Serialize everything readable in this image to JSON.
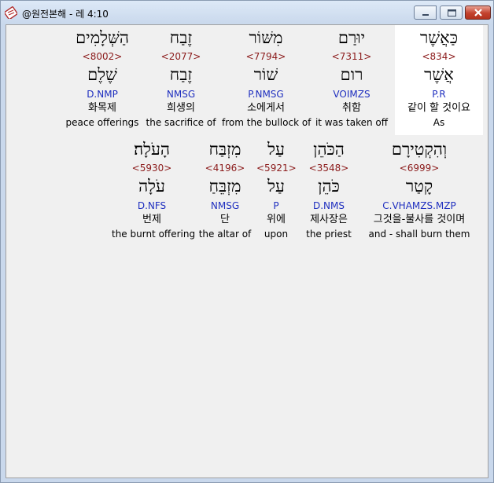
{
  "window": {
    "title": "@원전본해 - 레 4:10",
    "icons": [
      "app-bible-icon",
      "minimize-icon",
      "maximize-icon",
      "close-icon"
    ]
  },
  "colors": {
    "strong": "#8b1a1a",
    "parse": "#1f2fbf",
    "highlight_bg": "#ffffff",
    "content_bg": "#f0f0f0"
  },
  "words": [
    {
      "hebrew": "כַּאֲשֶׁר",
      "strong": "<834>",
      "root": "אֲשֶׁר",
      "parse": "P.R",
      "korean": "같이 할 것이요",
      "english": "As",
      "highlight": true
    },
    {
      "hebrew": "יוּרַם",
      "strong": "<7311>",
      "root": "רום",
      "parse": "VOIMZS",
      "korean": "취함",
      "english": "it was taken off",
      "highlight": false
    },
    {
      "hebrew": "מִשּׁוֹר",
      "strong": "<7794>",
      "root": "שׁוֹר",
      "parse": "P.NMSG",
      "korean": "소에게서",
      "english": "from the bullock of",
      "highlight": false
    },
    {
      "hebrew": "זֶבַח",
      "strong": "<2077>",
      "root": "זֶבַח",
      "parse": "NMSG",
      "korean": "희생의",
      "english": "the sacrifice of",
      "highlight": false
    },
    {
      "hebrew": "הַשְּׁלָמִים",
      "strong": "<8002>",
      "root": "שֶׁלֶם",
      "parse": "D.NMP",
      "korean": "화목제",
      "english": "peace offerings",
      "highlight": false
    },
    {
      "hebrew": "וְהִקְטִירָם",
      "strong": "<6999>",
      "root": "קָטַר",
      "parse": "C.VHAMZS.MZP",
      "korean": "그것을-불사를 것이며",
      "english": "and - shall burn them",
      "highlight": false
    },
    {
      "hebrew": "הַכֹּהֵן",
      "strong": "<3548>",
      "root": "כֹּהֵן",
      "parse": "D.NMS",
      "korean": "제사장은",
      "english": "the priest",
      "highlight": false
    },
    {
      "hebrew": "עַל",
      "strong": "<5921>",
      "root": "עַל",
      "parse": "P",
      "korean": "위에",
      "english": "upon",
      "highlight": false
    },
    {
      "hebrew": "מִזְבַּח",
      "strong": "<4196>",
      "root": "מִזְבֵּחַ",
      "parse": "NMSG",
      "korean": "단",
      "english": "the altar of",
      "highlight": false
    },
    {
      "hebrew": "הָעֹלָה׃",
      "strong": "<5930>",
      "root": "עֹלָה",
      "parse": "D.NFS",
      "korean": "번제",
      "english": "the burnt offering",
      "highlight": false
    }
  ]
}
